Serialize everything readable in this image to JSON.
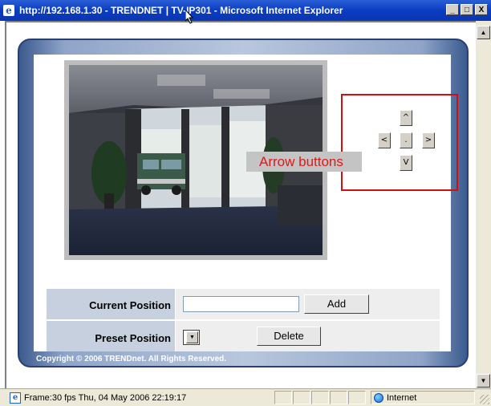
{
  "window": {
    "title": "http://192.168.1.30 - TRENDNET | TV-IP301 - Microsoft Internet Explorer",
    "minimize": "_",
    "maximize": "□",
    "close": "X"
  },
  "ptz": {
    "up": "^",
    "left": "<",
    "home": ".",
    "right": ">",
    "down": "V"
  },
  "annotation": {
    "callout": "Arrow buttons",
    "box_color": "#d01010",
    "text_color": "#e01818"
  },
  "controls": {
    "current_position_label": "Current Position",
    "current_position_value": "",
    "add_label": "Add",
    "preset_position_label": "Preset Position",
    "preset_selected": "",
    "delete_label": "Delete"
  },
  "footer": {
    "copyright": "Copyright © 2006 TRENDnet. All Rights Reserved."
  },
  "statusbar": {
    "text": "Frame:30 fps   Thu, 04 May 2006 22:19:17",
    "zone": "Internet"
  },
  "colors": {
    "titlebar": "#0a3cc2",
    "panel_frame": "#3b5a8e",
    "label_cell": "#c7d0df",
    "value_cell": "#eeeeee"
  },
  "icons": {
    "browser": "ie-icon",
    "zone": "globe-icon"
  }
}
